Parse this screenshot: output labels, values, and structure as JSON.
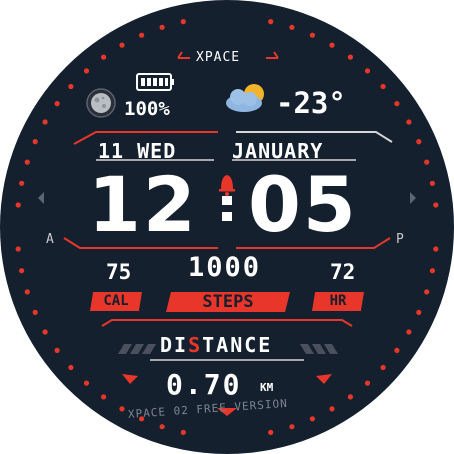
{
  "brand": "XPACE",
  "battery": {
    "percent_label": "100%",
    "level": 1.0,
    "icon": "battery-icon"
  },
  "moon": {
    "icon": "moon-phase-icon"
  },
  "weather": {
    "icon": "partly-cloudy-icon",
    "temperature": "-23°"
  },
  "date": {
    "day": "11 WED",
    "month": "JANUARY"
  },
  "time": {
    "hours": "12",
    "minutes": "05",
    "alarm_icon": "bell-icon"
  },
  "ampm": {
    "left": "A",
    "right": "P"
  },
  "stats": {
    "calories": {
      "value": "75",
      "label": "CAL"
    },
    "steps": {
      "value": "1000",
      "label": "STEPS"
    },
    "heart_rate": {
      "value": "72",
      "label": "HR"
    }
  },
  "distance": {
    "label_pre": "DI",
    "label_hl": "S",
    "label_post": "TANCE",
    "value": "0.70",
    "unit": "KM"
  },
  "footer": "XPACE 02 FREE VERSION",
  "colors": {
    "background": "#14202e",
    "accent": "#e8372a",
    "text": "#ffffff",
    "muted": "#7d8591"
  }
}
